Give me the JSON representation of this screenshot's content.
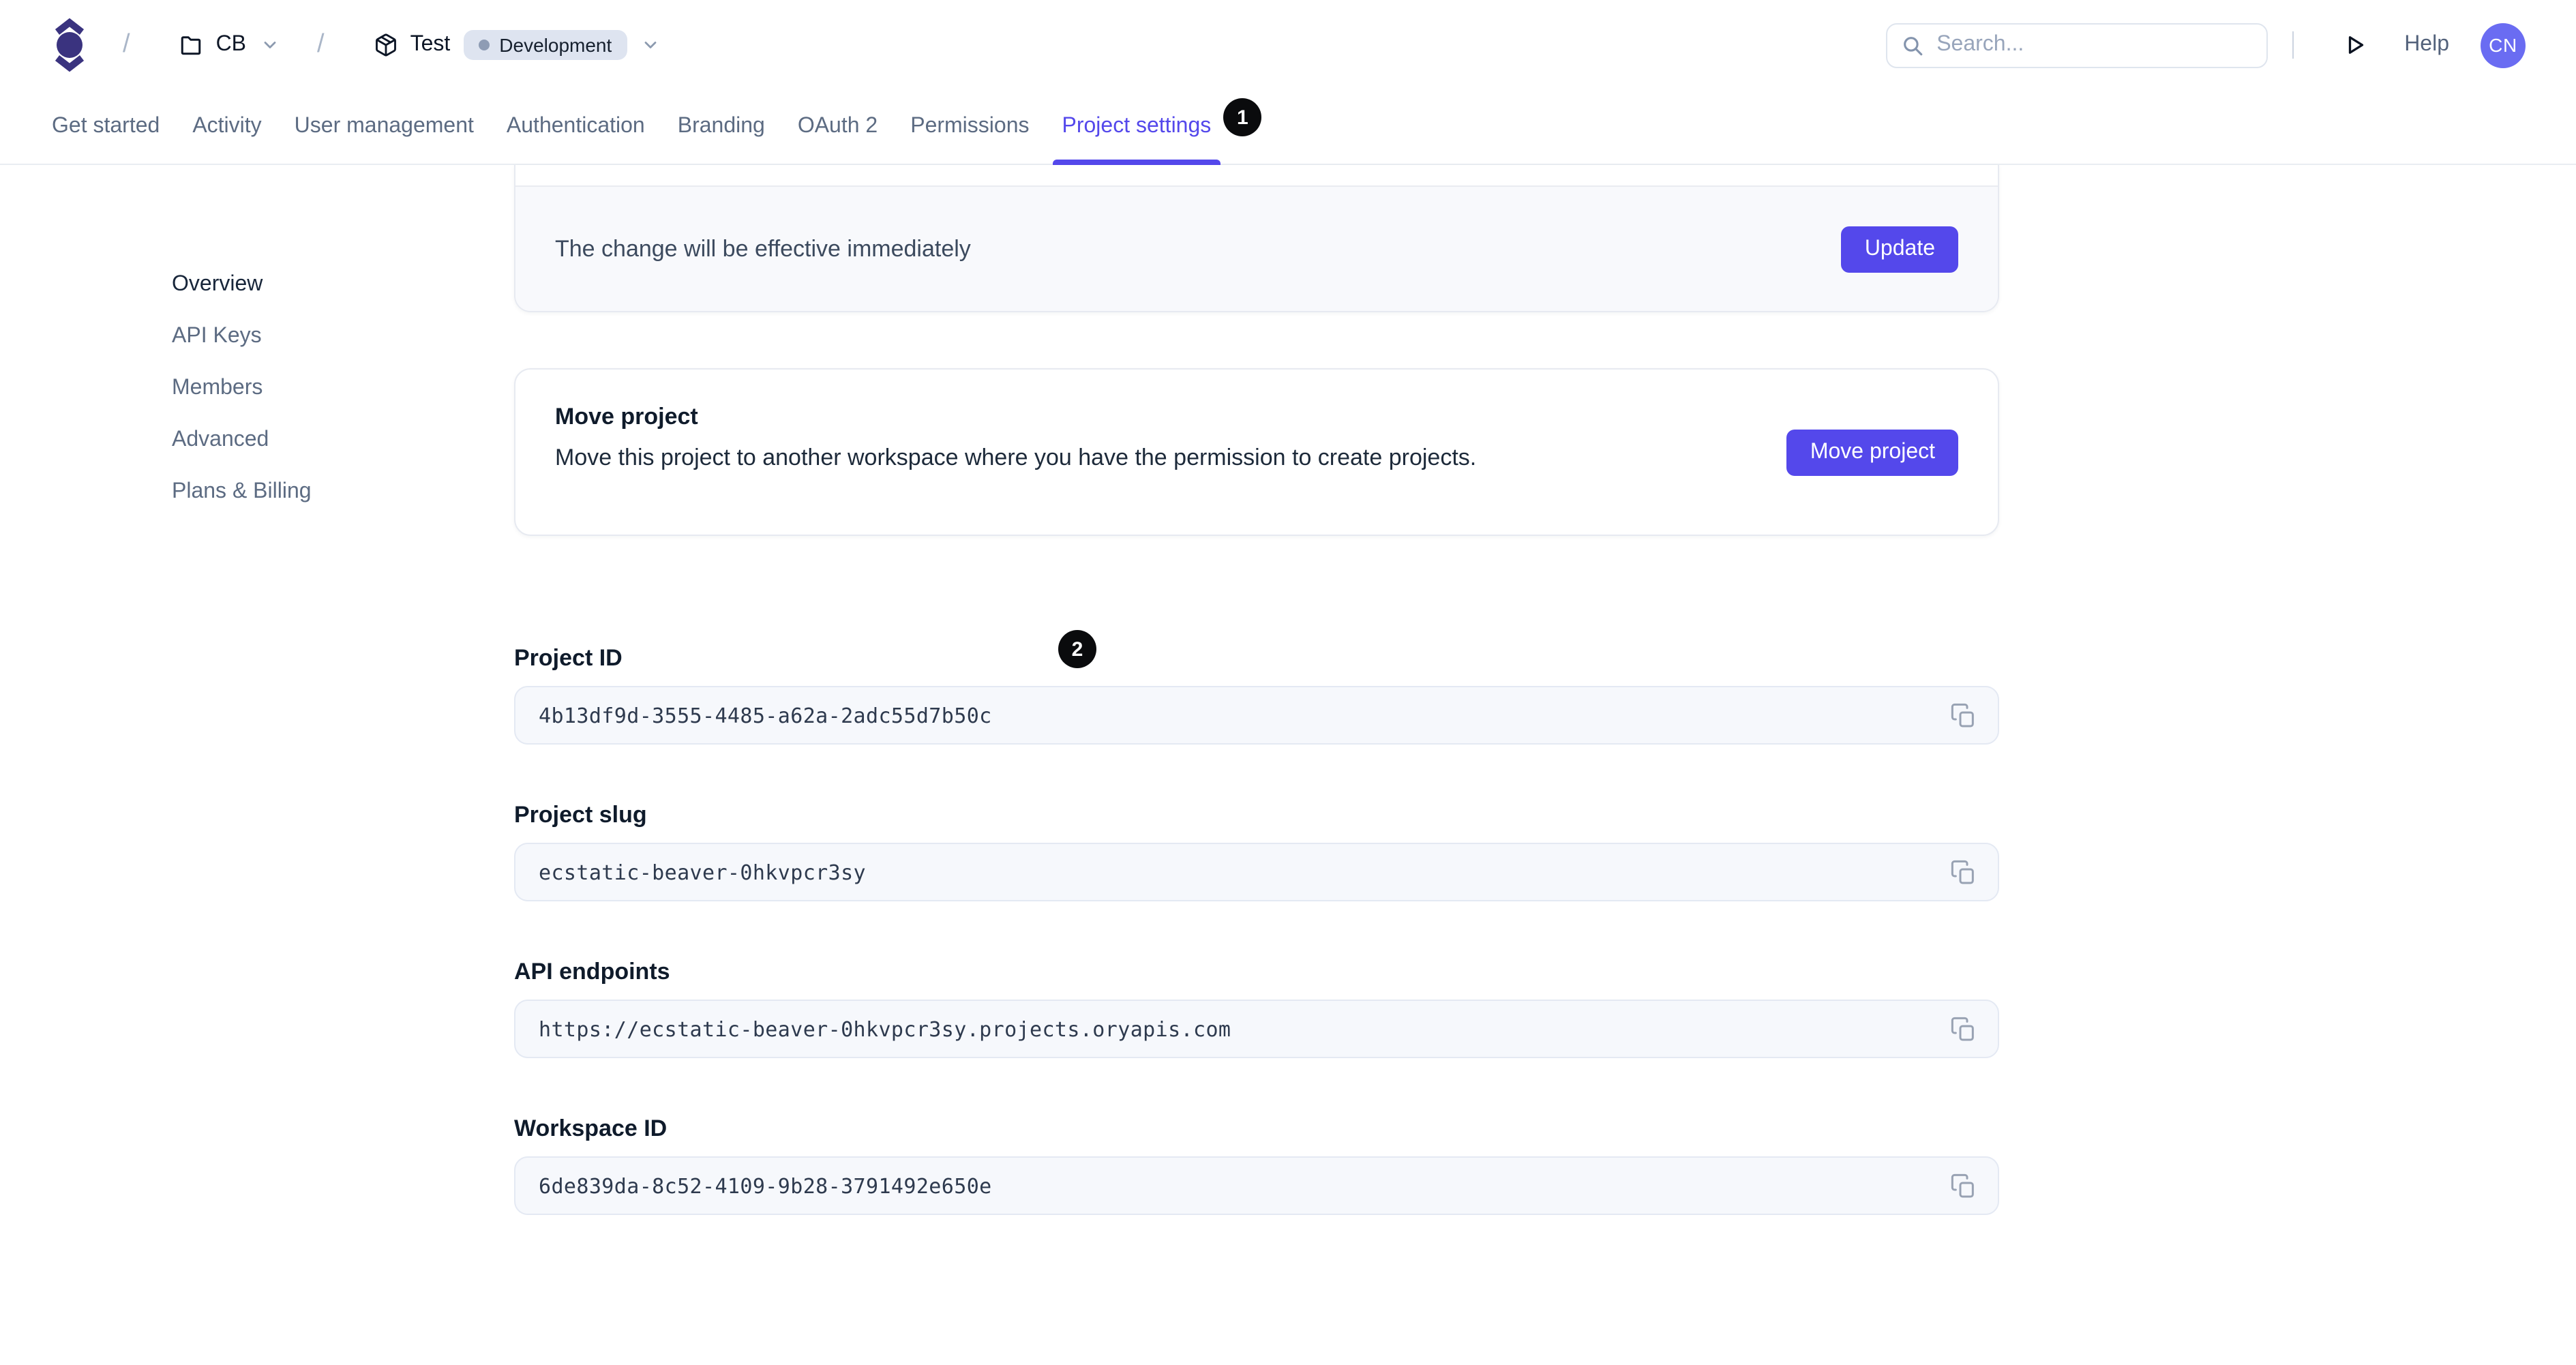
{
  "header": {
    "breadcrumb": {
      "separator": "/",
      "workspace_label": "CB",
      "project_label": "Test",
      "environment_badge": "Development"
    },
    "search": {
      "placeholder": "Search..."
    },
    "help_label": "Help",
    "avatar_initials": "CN",
    "icons": [
      "ory-logo",
      "folder-icon",
      "chevron-down-icon",
      "package-icon",
      "search-icon",
      "play-icon"
    ]
  },
  "tabs": {
    "items": [
      {
        "label": "Get started"
      },
      {
        "label": "Activity"
      },
      {
        "label": "User management"
      },
      {
        "label": "Authentication"
      },
      {
        "label": "Branding"
      },
      {
        "label": "OAuth 2"
      },
      {
        "label": "Permissions"
      },
      {
        "label": "Project settings"
      }
    ],
    "active": "Project settings"
  },
  "annotations": {
    "badge_1": "1",
    "badge_2": "2"
  },
  "sidebar": {
    "items": [
      "Overview",
      "API Keys",
      "Members",
      "Advanced",
      "Plans & Billing"
    ],
    "active": "Overview"
  },
  "update_card": {
    "note": "The change will be effective immediately",
    "button_label": "Update"
  },
  "move_card": {
    "title": "Move project",
    "description": "Move this project to another workspace where you have the permission to create projects.",
    "button_label": "Move project"
  },
  "fields": [
    {
      "label": "Project ID",
      "value": "4b13df9d-3555-4485-a62a-2adc55d7b50c"
    },
    {
      "label": "Project slug",
      "value": "ecstatic-beaver-0hkvpcr3sy"
    },
    {
      "label": "API endpoints",
      "value": "https://ecstatic-beaver-0hkvpcr3sy.projects.oryapis.com"
    },
    {
      "label": "Workspace ID",
      "value": "6de839da-8c52-4109-9b28-3791492e650e"
    }
  ],
  "colors": {
    "accent": "#5448EB",
    "avatar_bg": "#6A6CF2",
    "logo": "#3A337F",
    "annotation_badge_bg": "#0A0B0D",
    "input_bg": "#F6F8FC",
    "card_footer_bg": "#F8F9FC",
    "environment_badge_bg": "#DEE4F0"
  }
}
